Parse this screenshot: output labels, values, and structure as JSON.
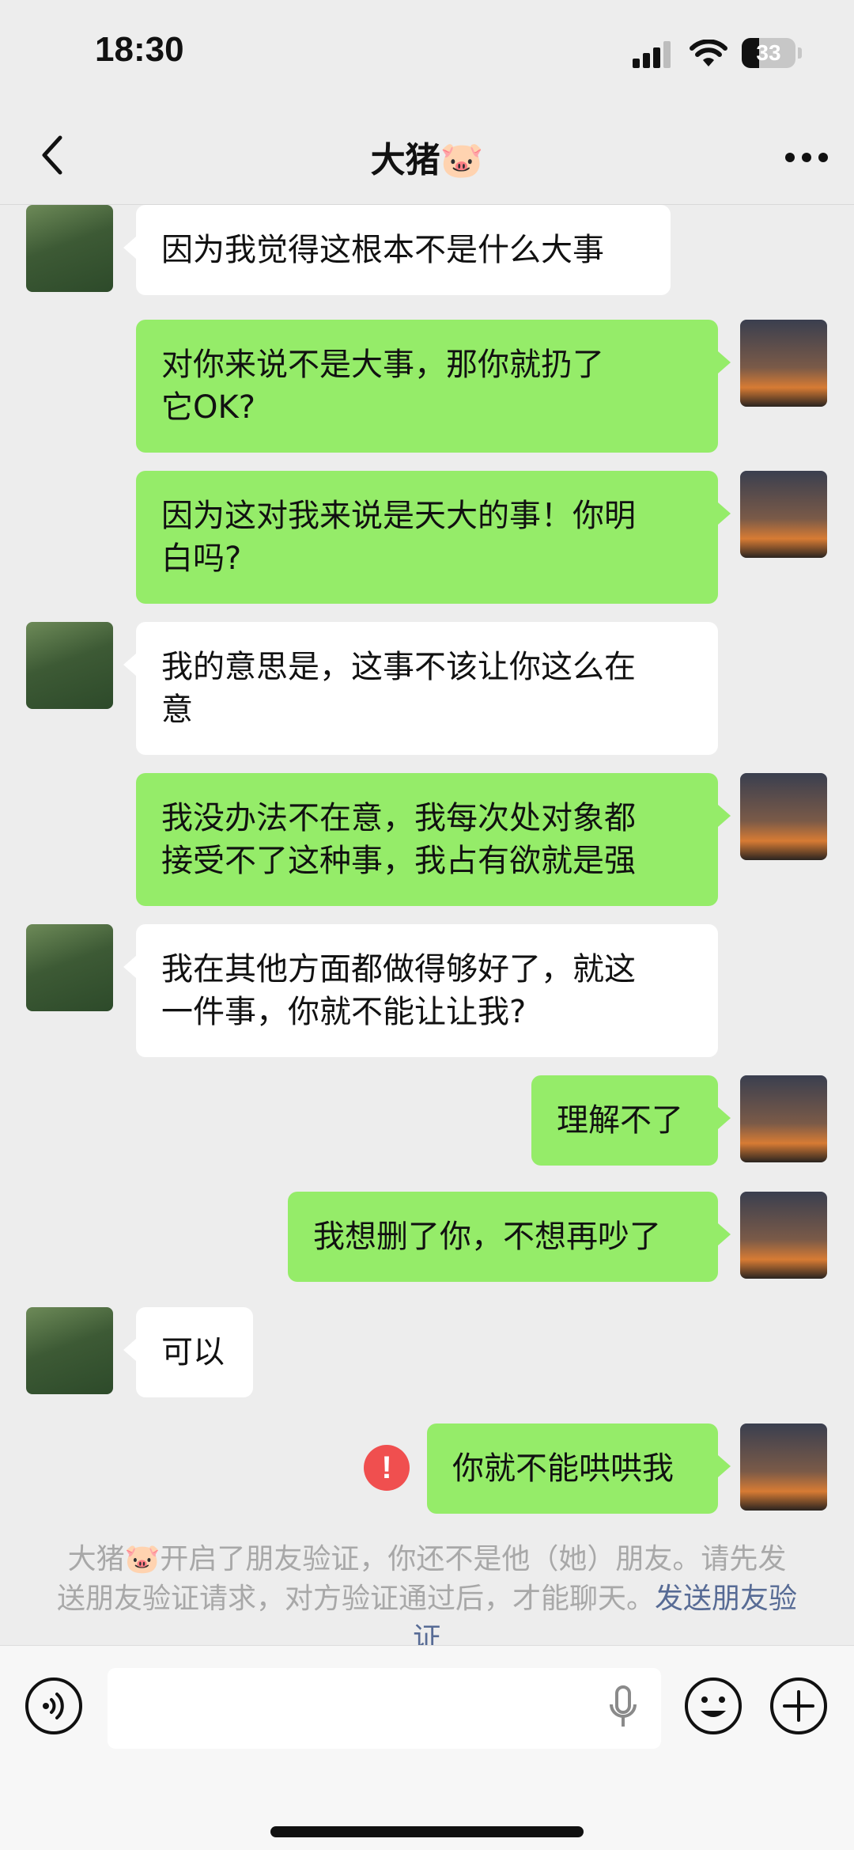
{
  "status_bar": {
    "time": "18:30",
    "battery": "33",
    "battery_level": 0.33
  },
  "header": {
    "title": "大猪🐷"
  },
  "messages": [
    {
      "from": "friend",
      "text": "因为我觉得这根本不是什么大事"
    },
    {
      "from": "me",
      "text": "对你来说不是大事，那你就扔了\n它OK?"
    },
    {
      "from": "me",
      "text": "因为这对我来说是天大的事！你明\n白吗?"
    },
    {
      "from": "friend",
      "text": "我的意思是，这事不该让你这么在\n意"
    },
    {
      "from": "me",
      "text": "我没办法不在意，我每次处对象都\n接受不了这种事，我占有欲就是强"
    },
    {
      "from": "friend",
      "text": "我在其他方面都做得够好了，就这\n一件事，你就不能让让我?"
    },
    {
      "from": "me",
      "text": "理解不了"
    },
    {
      "from": "me",
      "text": "我想删了你，不想再吵了"
    },
    {
      "from": "friend",
      "text": "可以"
    },
    {
      "from": "me",
      "text": "你就不能哄哄我",
      "failed": true,
      "error_mark": "!"
    }
  ],
  "system_notice": {
    "text": "大猪🐷开启了朋友验证，你还不是他（她）朋友。请先发送朋友验证请求，对方验证通过后，才能聊天。",
    "link": "发送朋友验证"
  },
  "input": {
    "placeholder": "",
    "value": ""
  },
  "icons": {
    "back": "chevron-left-icon",
    "more": "more-dots-icon",
    "voice": "voice-icon",
    "mic": "microphone-icon",
    "emoji": "emoji-icon",
    "plus": "plus-icon",
    "error": "exclamation-icon"
  },
  "colors": {
    "bubble_me": "#95ec69",
    "bubble_friend": "#ffffff",
    "background": "#ededed",
    "link": "#576b95",
    "error": "#f04f4f"
  }
}
